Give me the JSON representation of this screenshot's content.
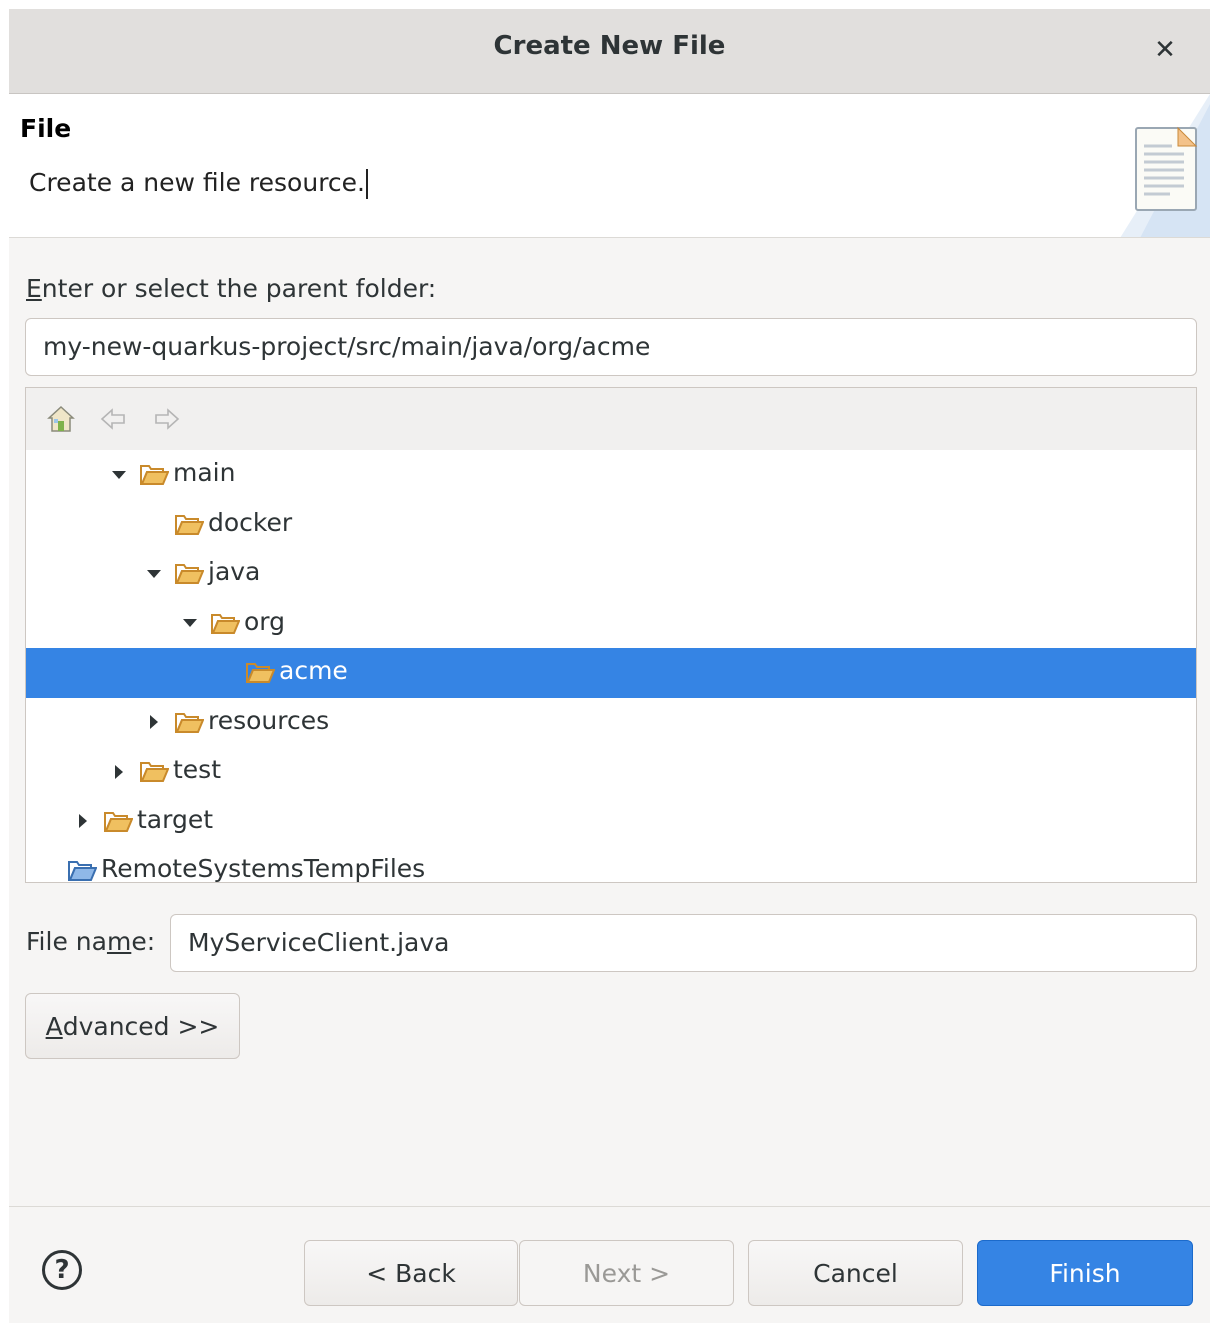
{
  "window": {
    "title": "Create New File"
  },
  "header": {
    "title": "File",
    "description": "Create a new file resource."
  },
  "parent_folder": {
    "label_prefix": "E",
    "label_rest": "nter or select the parent folder:",
    "value": "my-new-quarkus-project/src/main/java/org/acme"
  },
  "tree": {
    "toolbar": [
      "home-icon",
      "back-arrow-icon",
      "forward-arrow-icon"
    ],
    "rows": [
      {
        "label": "main",
        "expanded": "open"
      },
      {
        "label": "docker",
        "expanded": "none"
      },
      {
        "label": "java",
        "expanded": "open"
      },
      {
        "label": "org",
        "expanded": "open"
      },
      {
        "label": "acme",
        "expanded": "none",
        "selected": "true"
      },
      {
        "label": "resources",
        "expanded": "closed"
      },
      {
        "label": "test",
        "expanded": "closed"
      },
      {
        "label": "target",
        "expanded": "closed"
      },
      {
        "label": "RemoteSystemsTempFiles",
        "expanded": "none",
        "project": "true"
      }
    ]
  },
  "file_name": {
    "label_a": "File na",
    "label_u": "m",
    "label_b": "e:",
    "value": "MyServiceClient.java"
  },
  "buttons": {
    "advanced_u": "A",
    "advanced_rest": "dvanced >>",
    "back": "< Back",
    "next": "Next >",
    "cancel": "Cancel",
    "finish": "Finish",
    "help": "?"
  },
  "colors": {
    "selection": "#3584e4",
    "folder": "#e8b04b"
  }
}
